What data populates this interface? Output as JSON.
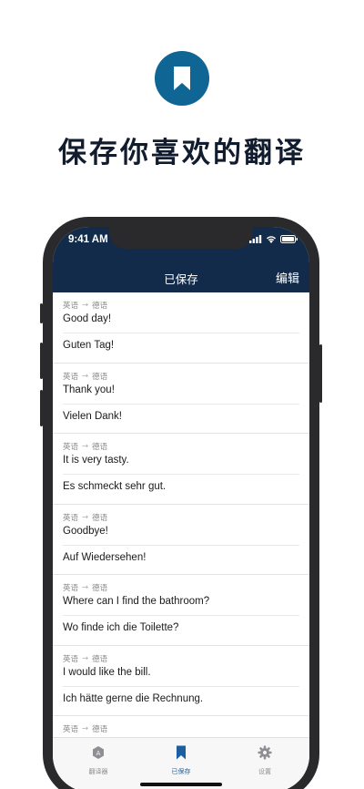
{
  "hero": {
    "icon": "bookmark-icon",
    "headline": "保存你喜欢的翻译",
    "accent": "#0f6594"
  },
  "status": {
    "time": "9:41 AM"
  },
  "navbar": {
    "title": "已保存",
    "edit_label": "编辑",
    "color": "#132b4a"
  },
  "entries": [
    {
      "from": "英语",
      "to": "德语",
      "source": "Good day!",
      "target": "Guten Tag!"
    },
    {
      "from": "英语",
      "to": "德语",
      "source": "Thank you!",
      "target": "Vielen Dank!"
    },
    {
      "from": "英语",
      "to": "德语",
      "source": "It is very tasty.",
      "target": "Es schmeckt sehr gut."
    },
    {
      "from": "英语",
      "to": "德语",
      "source": "Goodbye!",
      "target": "Auf Wiedersehen!"
    },
    {
      "from": "英语",
      "to": "德语",
      "source": "Where can I find the bathroom?",
      "target": "Wo finde ich die Toilette?"
    },
    {
      "from": "英语",
      "to": "德语",
      "source": "I would like the bill.",
      "target": "Ich hätte gerne die Rechnung."
    },
    {
      "from": "英语",
      "to": "德语",
      "source": "",
      "target": ""
    }
  ],
  "tabbar": {
    "tabs": [
      {
        "label": "翻译器",
        "icon": "translator-icon",
        "active": false
      },
      {
        "label": "已保存",
        "icon": "bookmark-icon",
        "active": true
      },
      {
        "label": "设置",
        "icon": "gear-icon",
        "active": false
      }
    ],
    "active_color": "#1a5fa0",
    "inactive_color": "#8e8e93"
  }
}
